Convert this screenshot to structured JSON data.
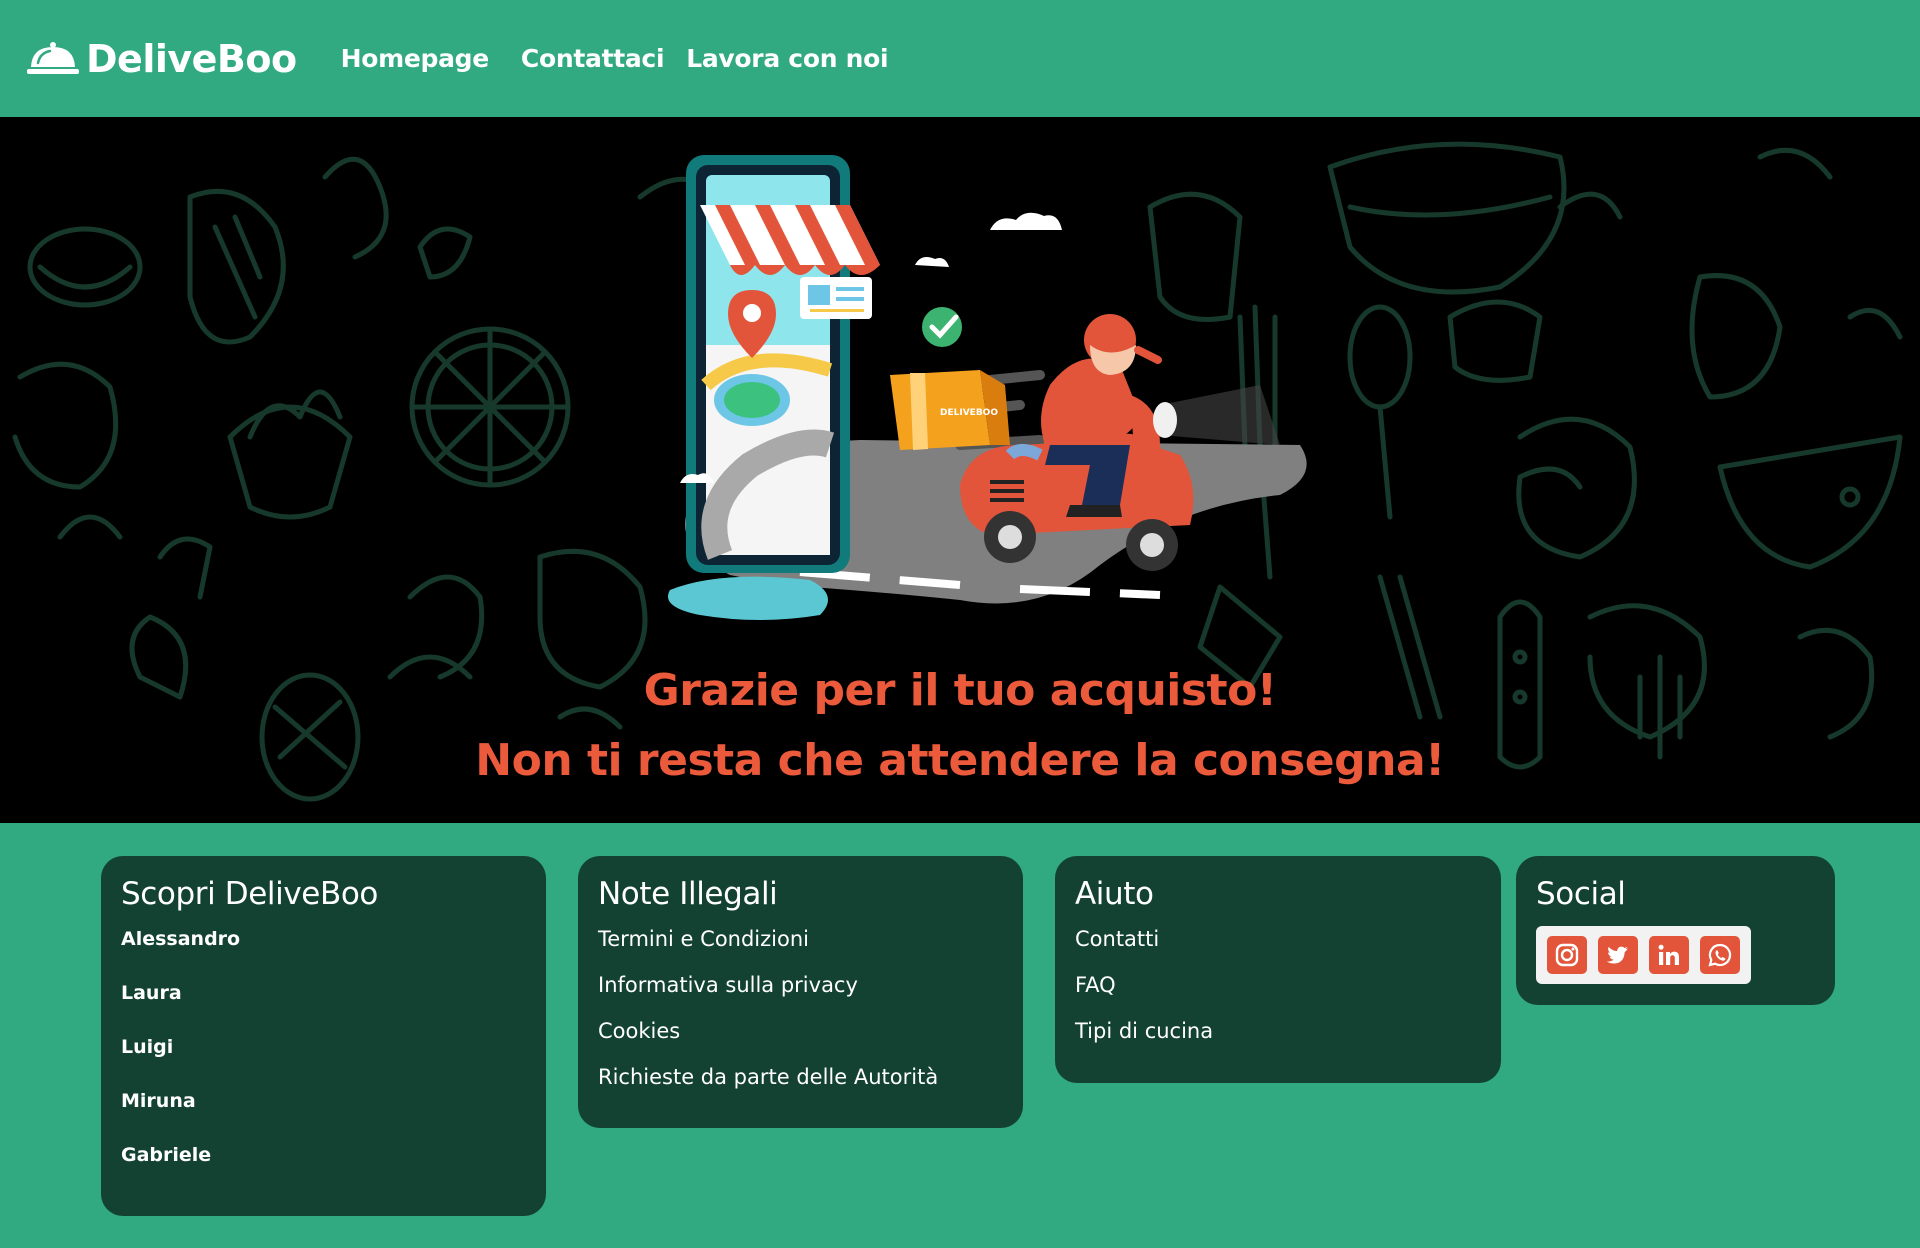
{
  "header": {
    "brand": "DeliveBoo",
    "brand_icon": "cloche-icon",
    "nav": [
      "Homepage",
      "Contattaci",
      "Lavora con noi"
    ]
  },
  "hero": {
    "line1": "Grazie per il tuo acquisto!",
    "line2": "Non ti resta che attendere la consegna!",
    "box_label": "DELIVEBOO"
  },
  "footer": {
    "about": {
      "title": "Scopri DeliveBoo",
      "members": [
        "Alessandro",
        "Laura",
        "Luigi",
        "Miruna",
        "Gabriele"
      ]
    },
    "legal": {
      "title": "Note Illegali",
      "links": [
        "Termini e Condizioni",
        "Informativa sulla privacy",
        "Cookies",
        "Richieste da parte delle Autorità"
      ]
    },
    "help": {
      "title": "Aiuto",
      "links": [
        "Contatti",
        "FAQ",
        "Tipi di cucina"
      ]
    },
    "social": {
      "title": "Social",
      "icons": [
        "instagram-icon",
        "twitter-icon",
        "linkedin-icon",
        "whatsapp-icon"
      ]
    }
  },
  "colors": {
    "brand_green": "#31aa81",
    "card_dark_green": "#144232",
    "accent_orange": "#ec5a3c",
    "hero_bg": "#000000"
  }
}
